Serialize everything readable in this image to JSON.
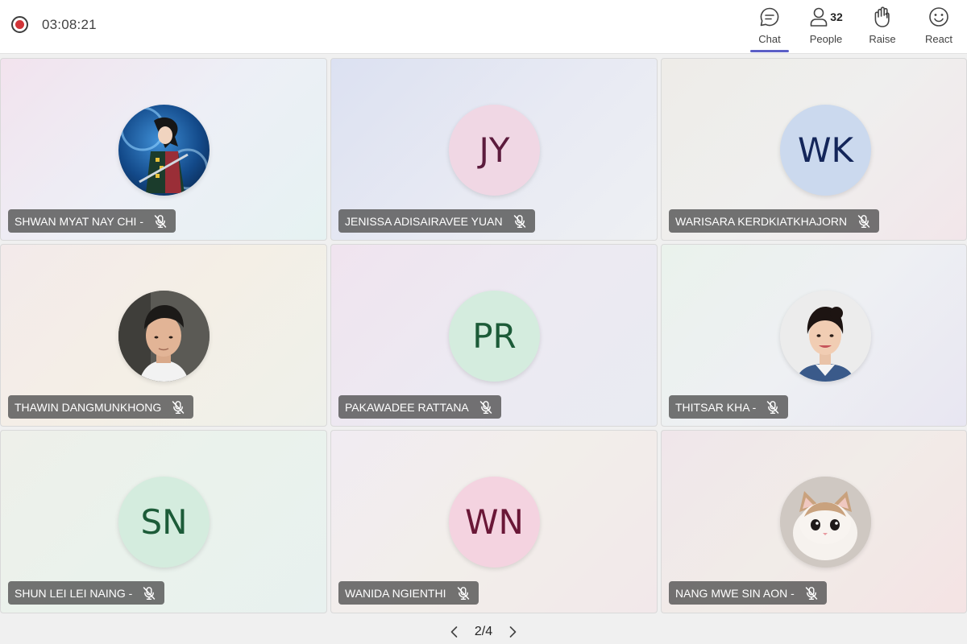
{
  "meeting": {
    "timer": "03:08:21",
    "recording_color": "#d13438"
  },
  "toolbar": {
    "chat_label": "Chat",
    "people_label": "People",
    "people_count": "32",
    "raise_label": "Raise",
    "react_label": "React",
    "accent_color": "#5b5fc7"
  },
  "participants": [
    {
      "name": "SHWAN MYAT NAY CHI -",
      "initials": "",
      "avatar": "anime-photo",
      "muted": true
    },
    {
      "name": "JENISSA ADISAIRAVEE YUAN",
      "initials": "JY",
      "avatar": "initials",
      "bg": "#f0d7e4",
      "fg": "#5c1b3d",
      "muted": true
    },
    {
      "name": "WARISARA KERDKIATKHAJORN",
      "initials": "WK",
      "avatar": "initials",
      "bg": "#cbd9ee",
      "fg": "#14265a",
      "muted": true
    },
    {
      "name": "THAWIN DANGMUNKHONG",
      "initials": "",
      "avatar": "person-photo",
      "muted": true
    },
    {
      "name": "PAKAWADEE RATTANA",
      "initials": "PR",
      "avatar": "initials",
      "bg": "#d4ecde",
      "fg": "#1c5b38",
      "muted": true
    },
    {
      "name": "THITSAR KHA -",
      "initials": "",
      "avatar": "person-photo",
      "muted": true
    },
    {
      "name": "SHUN LEI LEI NAING -",
      "initials": "SN",
      "avatar": "initials",
      "bg": "#d4ecde",
      "fg": "#1c5b38",
      "muted": true
    },
    {
      "name": "WANIDA NGIENTHI",
      "initials": "WN",
      "avatar": "initials",
      "bg": "#f4d3e0",
      "fg": "#6a1737",
      "muted": true
    },
    {
      "name": "NANG MWE SIN AON -",
      "initials": "",
      "avatar": "cat-photo",
      "muted": true
    }
  ],
  "pager": {
    "text": "2/4"
  }
}
